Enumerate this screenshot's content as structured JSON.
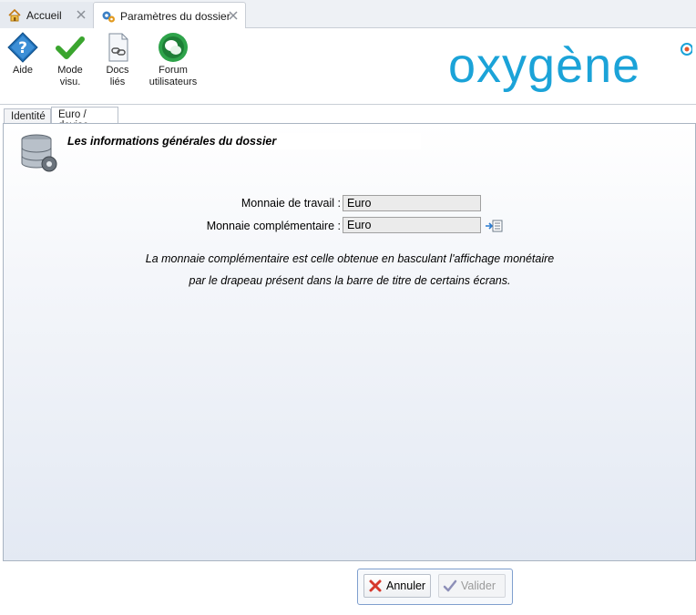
{
  "doc_tabs": [
    {
      "label": "Accueil",
      "icon": "home-icon",
      "closable": true
    },
    {
      "label": "Paramètres du dossier",
      "icon": "settings-gear-icon",
      "closable": true,
      "active": true
    }
  ],
  "ribbon": {
    "buttons": [
      {
        "label": "Aide",
        "icon": "help-icon"
      },
      {
        "label": "Mode visu.",
        "icon": "checkmark-icon"
      },
      {
        "label": "Docs liés",
        "icon": "linked-docs-icon"
      },
      {
        "label": "Forum utilisateurs",
        "icon": "forum-icon"
      }
    ]
  },
  "logo": {
    "text": "oxygène",
    "color": "#1ba3d8"
  },
  "inner_tabs": [
    {
      "label": "Identité"
    },
    {
      "label": "Euro / devise",
      "active": true
    }
  ],
  "panel": {
    "title": "Les informations générales du dossier",
    "fields": [
      {
        "label": "Monnaie de travail",
        "value": "Euro"
      },
      {
        "label": "Monnaie complémentaire",
        "value": "Euro"
      }
    ],
    "info_lines": [
      "La monnaie complémentaire est celle obtenue en basculant l'affichage monétaire",
      "par le drapeau présent dans la barre de titre de certains écrans."
    ]
  },
  "actions": {
    "annuler": "Annuler",
    "valider": "Valider"
  },
  "colors": {
    "accent": "#1ba3d8",
    "panel_border": "#a9b4c2",
    "button_group_border": "#7f9fce"
  }
}
